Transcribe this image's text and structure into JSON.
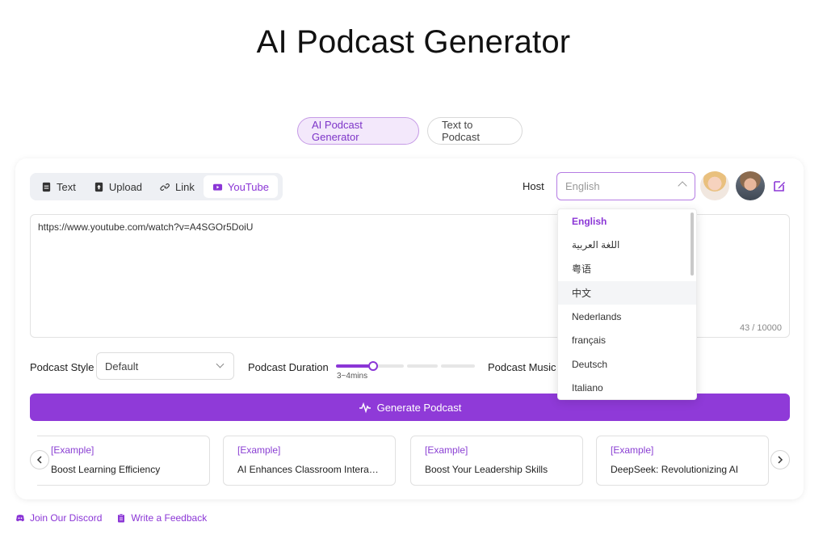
{
  "title": "AI Podcast Generator",
  "mode_tabs": [
    {
      "label": "AI Podcast Generator",
      "active": true
    },
    {
      "label": "Text to Podcast",
      "active": false
    }
  ],
  "source_tabs": [
    {
      "label": "Text",
      "icon": "document-icon"
    },
    {
      "label": "Upload",
      "icon": "upload-icon"
    },
    {
      "label": "Link",
      "icon": "link-icon"
    },
    {
      "label": "YouTube",
      "icon": "youtube-icon",
      "active": true
    }
  ],
  "host": {
    "label": "Host",
    "placeholder": "English",
    "dropdown_options": [
      "English",
      "اللغة العربية",
      "粤语",
      "中文",
      "Nederlands",
      "français",
      "Deutsch",
      "Italiano"
    ],
    "selected": "English",
    "hovered": "中文"
  },
  "input": {
    "value": "https://www.youtube.com/watch?v=A4SGOr5DoiU",
    "count": "43 / 10000"
  },
  "options": {
    "style_label": "Podcast Style",
    "style_value": "Default",
    "duration_label": "Podcast Duration",
    "duration_value": "3~4mins",
    "duration_level_fraction": 0.25,
    "music_label": "Podcast Music"
  },
  "generate_label": "Generate Podcast",
  "examples": [
    {
      "tag": "[Example]",
      "title": "Boost Learning Efficiency"
    },
    {
      "tag": "[Example]",
      "title": "AI Enhances Classroom Interaction"
    },
    {
      "tag": "[Example]",
      "title": "Boost Your Leadership Skills"
    },
    {
      "tag": "[Example]",
      "title": "DeepSeek: Revolutionizing AI"
    }
  ],
  "footer": {
    "discord": "Join Our Discord",
    "feedback": "Write a Feedback"
  },
  "colors": {
    "accent": "#8f3ad8",
    "accent_light": "#f3e8fb"
  }
}
